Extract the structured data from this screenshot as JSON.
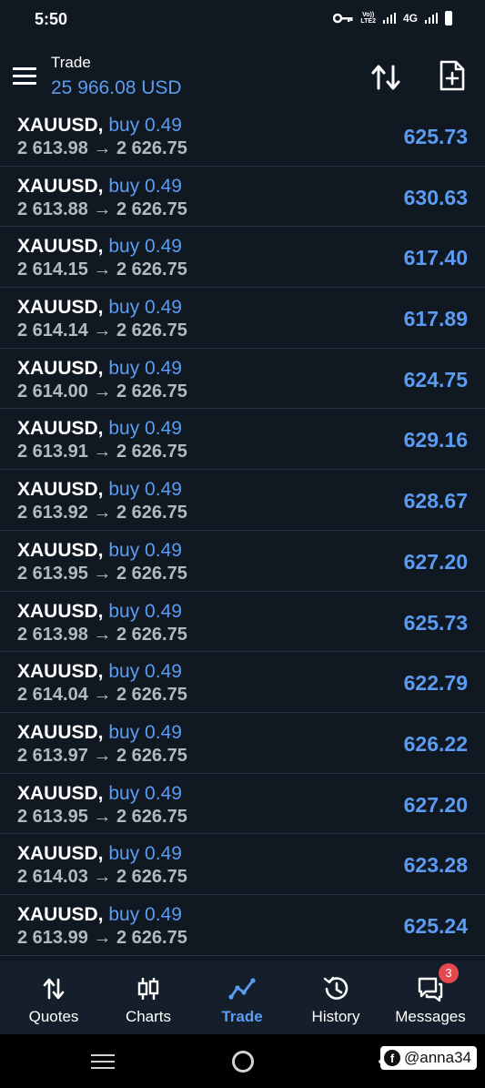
{
  "status_bar": {
    "time": "5:50",
    "network_top": "Vo))",
    "network_bottom": "LTE2",
    "network_type": "4G",
    "icons": [
      "key-icon",
      "signal-icon",
      "signal-icon",
      "battery-icon"
    ]
  },
  "header": {
    "title": "Trade",
    "balance": "25 966.08 USD",
    "icons": [
      "menu-icon",
      "sort-icon",
      "new-order-icon"
    ]
  },
  "trades": [
    {
      "symbol": "XAUUSD,",
      "side": "buy 0.49",
      "open": "2 613.98",
      "arrow": "→",
      "current": "2 626.75",
      "profit": "625.73"
    },
    {
      "symbol": "XAUUSD,",
      "side": "buy 0.49",
      "open": "2 613.88",
      "arrow": "→",
      "current": "2 626.75",
      "profit": "630.63"
    },
    {
      "symbol": "XAUUSD,",
      "side": "buy 0.49",
      "open": "2 614.15",
      "arrow": "→",
      "current": "2 626.75",
      "profit": "617.40"
    },
    {
      "symbol": "XAUUSD,",
      "side": "buy 0.49",
      "open": "2 614.14",
      "arrow": "→",
      "current": "2 626.75",
      "profit": "617.89"
    },
    {
      "symbol": "XAUUSD,",
      "side": "buy 0.49",
      "open": "2 614.00",
      "arrow": "→",
      "current": "2 626.75",
      "profit": "624.75"
    },
    {
      "symbol": "XAUUSD,",
      "side": "buy 0.49",
      "open": "2 613.91",
      "arrow": "→",
      "current": "2 626.75",
      "profit": "629.16"
    },
    {
      "symbol": "XAUUSD,",
      "side": "buy 0.49",
      "open": "2 613.92",
      "arrow": "→",
      "current": "2 626.75",
      "profit": "628.67"
    },
    {
      "symbol": "XAUUSD,",
      "side": "buy 0.49",
      "open": "2 613.95",
      "arrow": "→",
      "current": "2 626.75",
      "profit": "627.20"
    },
    {
      "symbol": "XAUUSD,",
      "side": "buy 0.49",
      "open": "2 613.98",
      "arrow": "→",
      "current": "2 626.75",
      "profit": "625.73"
    },
    {
      "symbol": "XAUUSD,",
      "side": "buy 0.49",
      "open": "2 614.04",
      "arrow": "→",
      "current": "2 626.75",
      "profit": "622.79"
    },
    {
      "symbol": "XAUUSD,",
      "side": "buy 0.49",
      "open": "2 613.97",
      "arrow": "→",
      "current": "2 626.75",
      "profit": "626.22"
    },
    {
      "symbol": "XAUUSD,",
      "side": "buy 0.49",
      "open": "2 613.95",
      "arrow": "→",
      "current": "2 626.75",
      "profit": "627.20"
    },
    {
      "symbol": "XAUUSD,",
      "side": "buy 0.49",
      "open": "2 614.03",
      "arrow": "→",
      "current": "2 626.75",
      "profit": "623.28"
    },
    {
      "symbol": "XAUUSD,",
      "side": "buy 0.49",
      "open": "2 613.99",
      "arrow": "→",
      "current": "2 626.75",
      "profit": "625.24"
    }
  ],
  "bottom_nav": {
    "items": [
      {
        "label": "Quotes",
        "icon": "quotes-icon",
        "active": false
      },
      {
        "label": "Charts",
        "icon": "candlestick-icon",
        "active": false
      },
      {
        "label": "Trade",
        "icon": "trade-line-icon",
        "active": true
      },
      {
        "label": "History",
        "icon": "history-icon",
        "active": false
      },
      {
        "label": "Messages",
        "icon": "messages-icon",
        "active": false
      }
    ],
    "messages_badge": "3"
  },
  "system_nav": {
    "icons": [
      "recent-apps-icon",
      "home-icon",
      "back-icon"
    ]
  },
  "watermark": {
    "text": "@anna34",
    "icon": "facebook-icon"
  },
  "colors": {
    "background": "#101822",
    "accent": "#5b9cf2",
    "secondary_text": "#b3b9c2",
    "badge": "#e5484d"
  }
}
